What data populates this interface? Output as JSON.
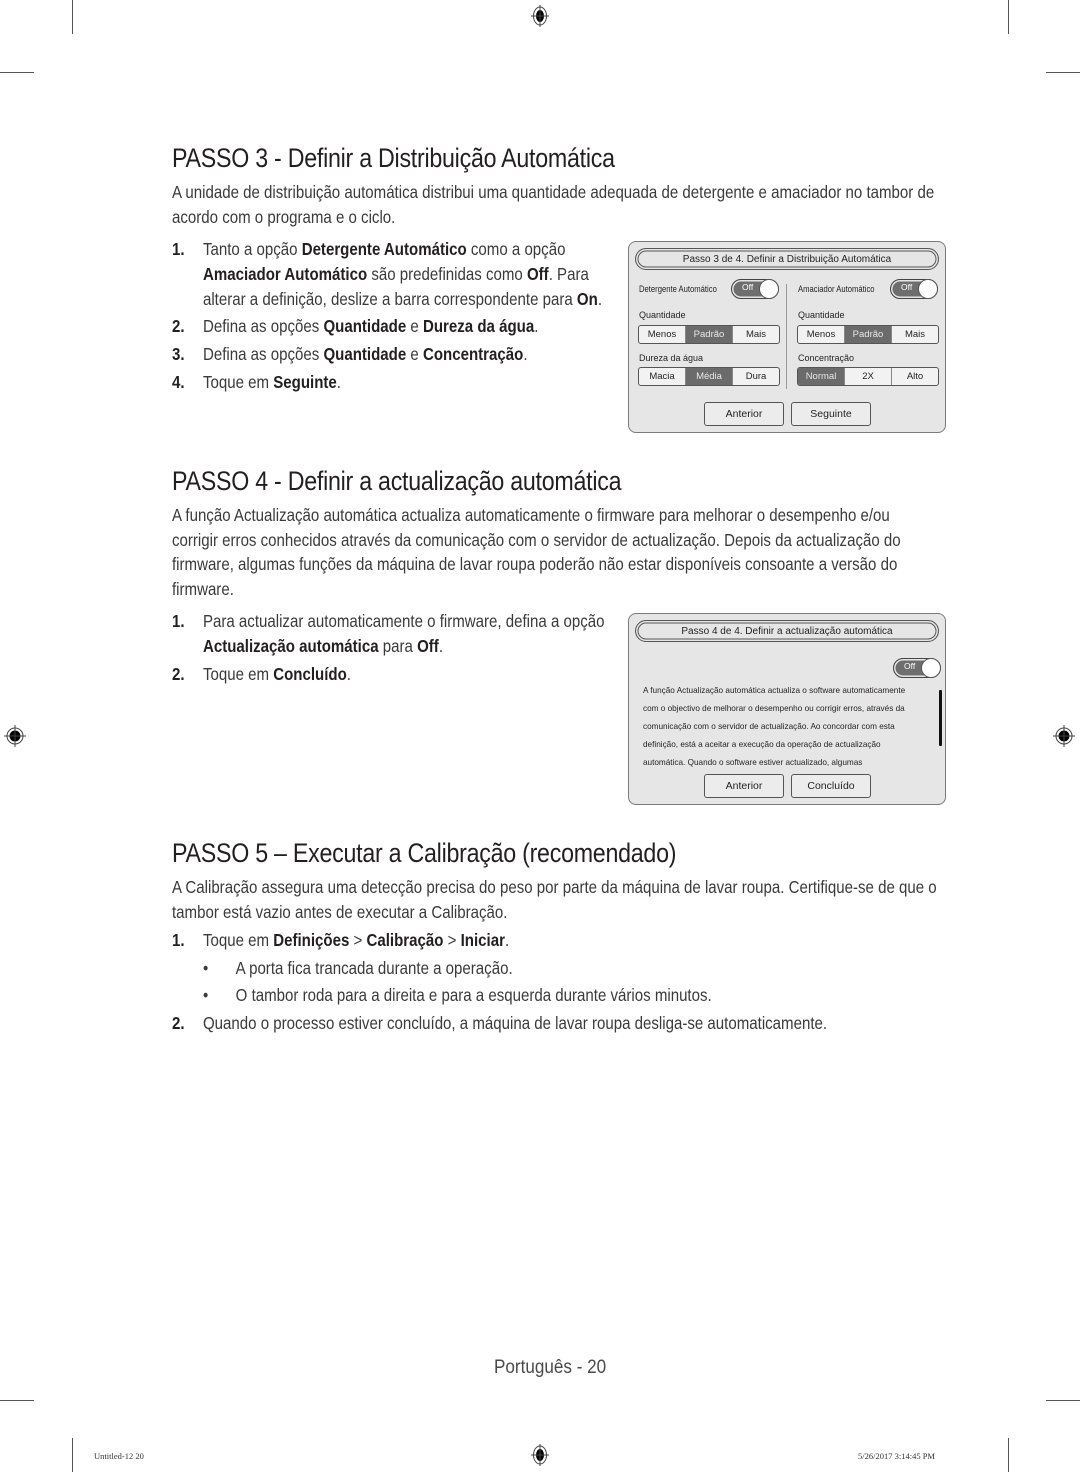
{
  "step3": {
    "title": "PASSO 3 - Definir a Distribuição Automática",
    "intro": "A unidade de distribuição automática distribui uma quantidade adequada de detergente e amaciador no tambor de acordo com o programa e o ciclo.",
    "items": [
      {
        "num": "1.",
        "line1_pre": "Tanto a opção ",
        "line1_b1": "Detergente Automático",
        "line1_post": " como a opção",
        "line2_b1": "Amaciador Automático",
        "line2_mid": " são predefinidas como ",
        "line2_b2": "Off",
        "line2_post": ". Para",
        "line3_pre": "alterar a definição, deslize a barra correspondente para ",
        "line3_b1": "On",
        "line3_post": "."
      },
      {
        "num": "2.",
        "pre": "Defina as opções ",
        "b1": "Quantidade",
        "mid": " e ",
        "b2": "Dureza da água",
        "post": "."
      },
      {
        "num": "3.",
        "pre": "Defina as opções ",
        "b1": "Quantidade",
        "mid": " e ",
        "b2": "Concentração",
        "post": "."
      },
      {
        "num": "4.",
        "pre": "Toque em ",
        "b1": "Seguinte",
        "post": "."
      }
    ],
    "panel": {
      "title": "Passo 3 de 4. Definir a Distribuição Automática",
      "left": {
        "toggle_label": "Detergente Automático",
        "toggle_state": "Off",
        "qty_label": "Quantidade",
        "qty_options": [
          "Menos",
          "Padrão",
          "Mais"
        ],
        "qty_selected": "Padrão",
        "hard_label": "Dureza da água",
        "hard_options": [
          "Macia",
          "Média",
          "Dura"
        ],
        "hard_selected": "Média"
      },
      "right": {
        "toggle_label": "Amaciador Automático",
        "toggle_state": "Off",
        "qty_label": "Quantidade",
        "qty_options": [
          "Menos",
          "Padrão",
          "Mais"
        ],
        "qty_selected": "Padrão",
        "conc_label": "Concentração",
        "conc_options": [
          "Normal",
          "2X",
          "Alto"
        ],
        "conc_selected": "Normal"
      },
      "prev_button": "Anterior",
      "next_button": "Seguinte"
    }
  },
  "step4": {
    "title": "PASSO 4 - Definir a actualização automática",
    "intro_lines": [
      "A função Actualização automática actualiza automaticamente o firmware para melhorar o desempenho e/ou",
      "corrigir erros conhecidos através da comunicação com o servidor de actualização. Depois da actualização do",
      "firmware, algumas funções da máquina de lavar roupa poderão não estar disponíveis consoante a versão do",
      "firmware."
    ],
    "items": [
      {
        "num": "1.",
        "line1": "Para actualizar automaticamente o firmware, defina a opção",
        "line2_b1": "Actualização automática",
        "line2_mid": " para ",
        "line2_b2": "Off",
        "line2_post": "."
      },
      {
        "num": "2.",
        "pre": "Toque em ",
        "b1": "Concluído",
        "post": "."
      }
    ],
    "panel": {
      "title": "Passo 4 de 4. Definir a actualização automática",
      "toggle_state": "Off",
      "body_lines": [
        "A função Actualização automática actualiza o software automaticamente",
        "com o objectivo de melhorar o desempenho ou corrigir erros, através da",
        "comunicação com o servidor de actualização. Ao concordar com esta",
        "definição, está a aceitar a execução da operação de actualização",
        "automática. Quando o software estiver actualizado, algumas"
      ],
      "prev_button": "Anterior",
      "done_button": "Concluído"
    }
  },
  "step5": {
    "title": "PASSO 5 – Executar a Calibração (recomendado)",
    "intro_lines": [
      "A Calibração assegura uma detecção precisa do peso por parte da máquina de lavar roupa. Certifique-se de que o",
      "tambor está vazio antes de executar a Calibração."
    ],
    "item1": {
      "num": "1.",
      "pre": "Toque em ",
      "b1": "Definições",
      "sep1": " > ",
      "b2": "Calibração",
      "sep2": " > ",
      "b3": "Iniciar",
      "post": "."
    },
    "bullets": [
      "A porta fica trancada durante a operação.",
      "O tambor roda para a direita e para a esquerda durante vários minutos."
    ],
    "item2": {
      "num": "2.",
      "text": "Quando o processo estiver concluído, a máquina de lavar roupa desliga-se automaticamente."
    }
  },
  "footer": {
    "page_label": "Português - 20",
    "slug_left": "Untitled-12   20",
    "slug_right": "5/26/2017   3:14:45 PM"
  }
}
